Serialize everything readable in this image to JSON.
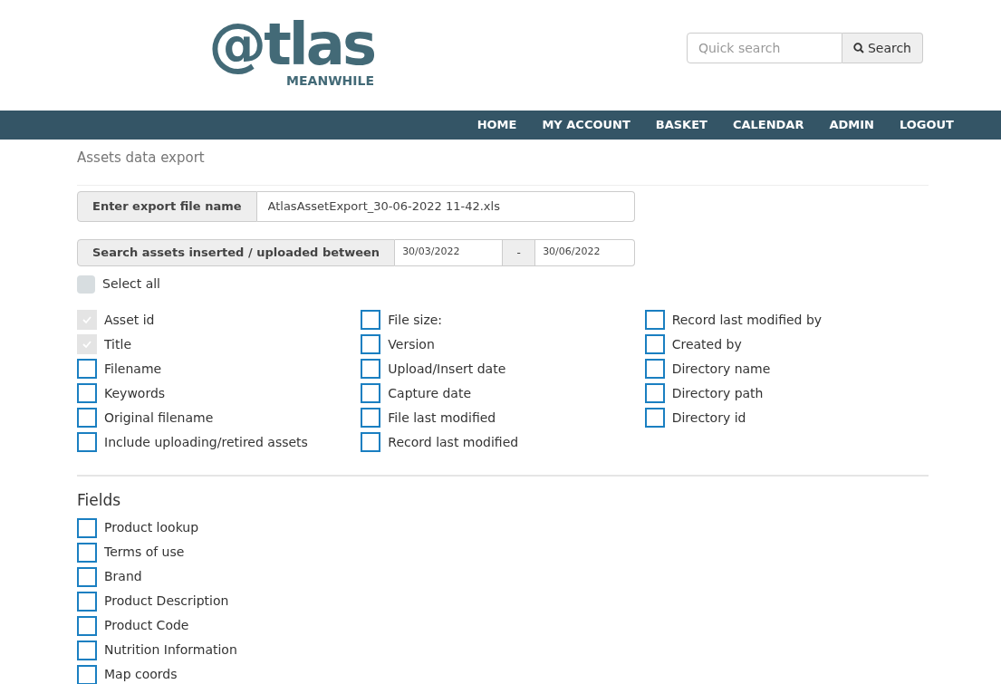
{
  "logo": {
    "wordmark": "@tlas",
    "tagline": "MEANWHILE"
  },
  "search": {
    "placeholder": "Quick search",
    "button": "Search"
  },
  "nav": [
    "HOME",
    "MY ACCOUNT",
    "BASKET",
    "CALENDAR",
    "ADMIN",
    "LOGOUT"
  ],
  "page_title": "Assets data export",
  "filename": {
    "label": "Enter export file name",
    "value": "AtlasAssetExport_30-06-2022 11-42.xls"
  },
  "date_range": {
    "label": "Search assets inserted / uploaded between",
    "from": "30/03/2022",
    "separator": "-",
    "to": "30/06/2022"
  },
  "select_all": {
    "label": "Select all",
    "checked": false
  },
  "columns": [
    [
      {
        "label": "Asset id",
        "checked": true,
        "disabled": true
      },
      {
        "label": "Title",
        "checked": true,
        "disabled": true
      },
      {
        "label": "Filename",
        "checked": false,
        "disabled": false
      },
      {
        "label": "Keywords",
        "checked": false,
        "disabled": false
      },
      {
        "label": "Original filename",
        "checked": false,
        "disabled": false
      },
      {
        "label": "Include uploading/retired assets",
        "checked": false,
        "disabled": false
      }
    ],
    [
      {
        "label": "File size:",
        "checked": false,
        "disabled": false
      },
      {
        "label": "Version",
        "checked": false,
        "disabled": false
      },
      {
        "label": "Upload/Insert date",
        "checked": false,
        "disabled": false
      },
      {
        "label": "Capture date",
        "checked": false,
        "disabled": false
      },
      {
        "label": "File last modified",
        "checked": false,
        "disabled": false
      },
      {
        "label": "Record last modified",
        "checked": false,
        "disabled": false
      }
    ],
    [
      {
        "label": "Record last modified by",
        "checked": false,
        "disabled": false
      },
      {
        "label": "Created by",
        "checked": false,
        "disabled": false
      },
      {
        "label": "Directory name",
        "checked": false,
        "disabled": false
      },
      {
        "label": "Directory path",
        "checked": false,
        "disabled": false
      },
      {
        "label": "Directory id",
        "checked": false,
        "disabled": false
      }
    ]
  ],
  "fields_heading": "Fields",
  "fields": [
    {
      "label": "Product lookup",
      "checked": false,
      "disabled": false
    },
    {
      "label": "Terms of use",
      "checked": false,
      "disabled": false
    },
    {
      "label": "Brand",
      "checked": false,
      "disabled": false
    },
    {
      "label": "Product Description",
      "checked": false,
      "disabled": false
    },
    {
      "label": "Product Code",
      "checked": false,
      "disabled": false
    },
    {
      "label": "Nutrition Information",
      "checked": false,
      "disabled": false
    },
    {
      "label": "Map coords",
      "checked": false,
      "disabled": false
    }
  ]
}
